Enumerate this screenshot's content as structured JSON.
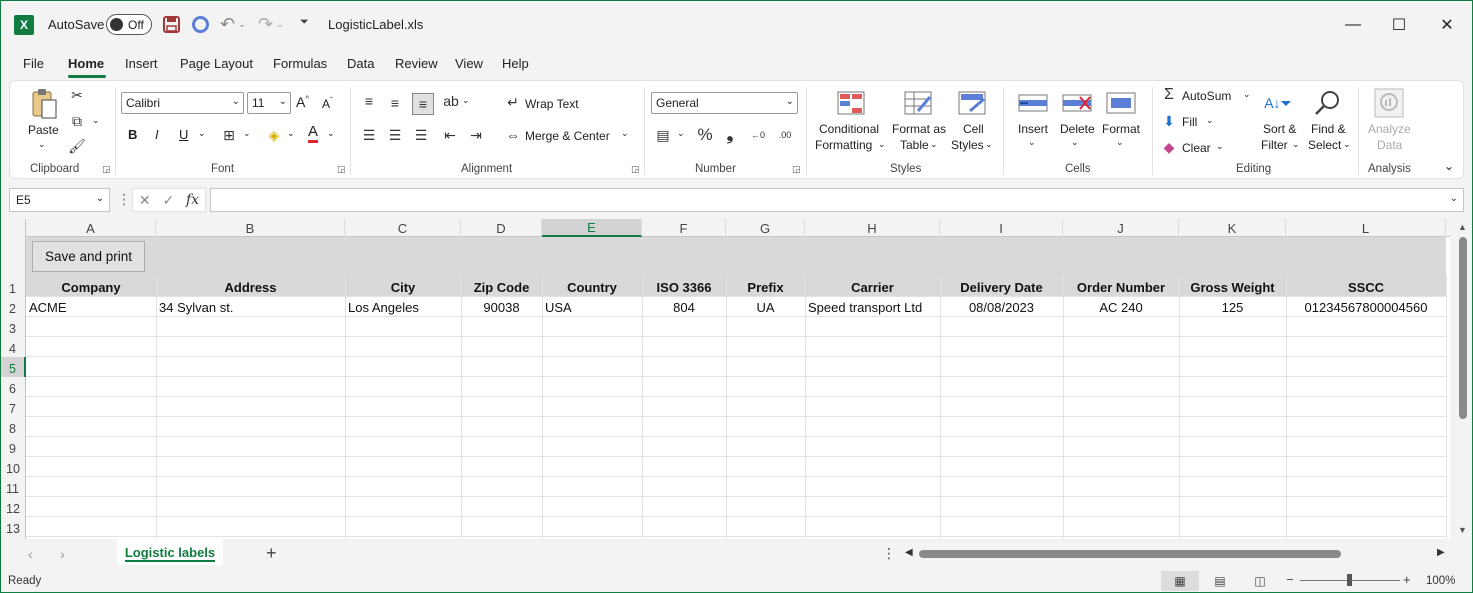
{
  "titlebar": {
    "app_logo": "X",
    "autosave_label": "AutoSave",
    "autosave_state": "Off",
    "doc_title": "LogisticLabel.xls",
    "icons": [
      "save-icon",
      "sync-icon",
      "undo-icon",
      "redo-icon",
      "customize-qat-icon",
      "minimize-icon",
      "maximize-icon",
      "close-icon"
    ]
  },
  "menu": {
    "tabs": [
      "File",
      "Home",
      "Insert",
      "Page Layout",
      "Formulas",
      "Data",
      "Review",
      "View",
      "Help"
    ],
    "active": "Home"
  },
  "ribbon": {
    "clipboard": {
      "paste_label": "Paste",
      "group_label": "Clipboard"
    },
    "font": {
      "font_name": "Calibri",
      "font_size": "11",
      "group_label": "Font",
      "bold": "B",
      "italic": "I",
      "underline": "U"
    },
    "alignment": {
      "wrap_text": "Wrap Text",
      "merge_center": "Merge & Center",
      "group_label": "Alignment"
    },
    "number": {
      "format": "General",
      "group_label": "Number"
    },
    "styles": {
      "conditional_1": "Conditional",
      "conditional_2": "Formatting",
      "format_table_1": "Format as",
      "format_table_2": "Table",
      "cell_styles_1": "Cell",
      "cell_styles_2": "Styles",
      "group_label": "Styles"
    },
    "cells": {
      "insert": "Insert",
      "delete": "Delete",
      "format": "Format",
      "group_label": "Cells"
    },
    "editing": {
      "autosum": "AutoSum",
      "fill": "Fill",
      "clear": "Clear",
      "sort_1": "Sort &",
      "sort_2": "Filter",
      "find_1": "Find &",
      "find_2": "Select",
      "group_label": "Editing"
    },
    "analysis": {
      "analyze_1": "Analyze",
      "analyze_2": "Data",
      "group_label": "Analysis"
    }
  },
  "formula_bar": {
    "name_box": "E5",
    "formula": ""
  },
  "grid": {
    "columns": [
      "A",
      "B",
      "C",
      "D",
      "E",
      "F",
      "G",
      "H",
      "I",
      "J",
      "K",
      "L"
    ],
    "selected_column": "E",
    "rows": [
      "1",
      "2",
      "3",
      "4",
      "5",
      "6",
      "7",
      "8",
      "9",
      "10",
      "11",
      "12",
      "13"
    ],
    "selected_row": "5",
    "button_label": "Save and print",
    "headers": [
      "Company",
      "Address",
      "City",
      "Zip Code",
      "Country",
      "ISO 3366",
      "Prefix",
      "Carrier",
      "Delivery Date",
      "Order Number",
      "Gross Weight",
      "SSCC"
    ],
    "data_row": [
      "ACME",
      "34 Sylvan st.",
      "Los Angeles",
      "90038",
      "USA",
      "804",
      "UA",
      "Speed transport Ltd",
      "08/08/2023",
      "AC 240",
      "125",
      "01234567800004560"
    ]
  },
  "sheets": {
    "tabs": [
      "Logistic labels"
    ],
    "active": "Logistic labels"
  },
  "status": {
    "text": "Ready",
    "zoom": "100%"
  }
}
